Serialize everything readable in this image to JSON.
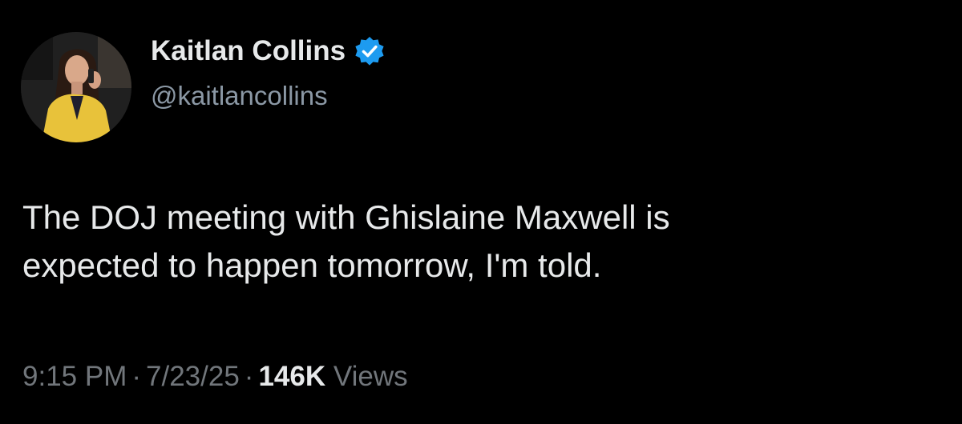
{
  "author": {
    "display_name": "Kaitlan Collins",
    "handle": "@kaitlancollins",
    "verified": true,
    "verified_badge_color": "#1d9bf0",
    "avatar_icon": "profile-photo"
  },
  "tweet": {
    "text_lines": [
      "The DOJ meeting with Ghislaine Maxwell is",
      "expected to happen tomorrow, I'm told."
    ]
  },
  "meta": {
    "time": "9:15 PM",
    "separator": "·",
    "date": "7/23/25",
    "views_count": "146K",
    "views_label": "Views"
  },
  "colors": {
    "background": "#000000",
    "primary_text": "#e7e9ea",
    "secondary_text": "#71767b",
    "handle_text": "#8b98a5"
  }
}
